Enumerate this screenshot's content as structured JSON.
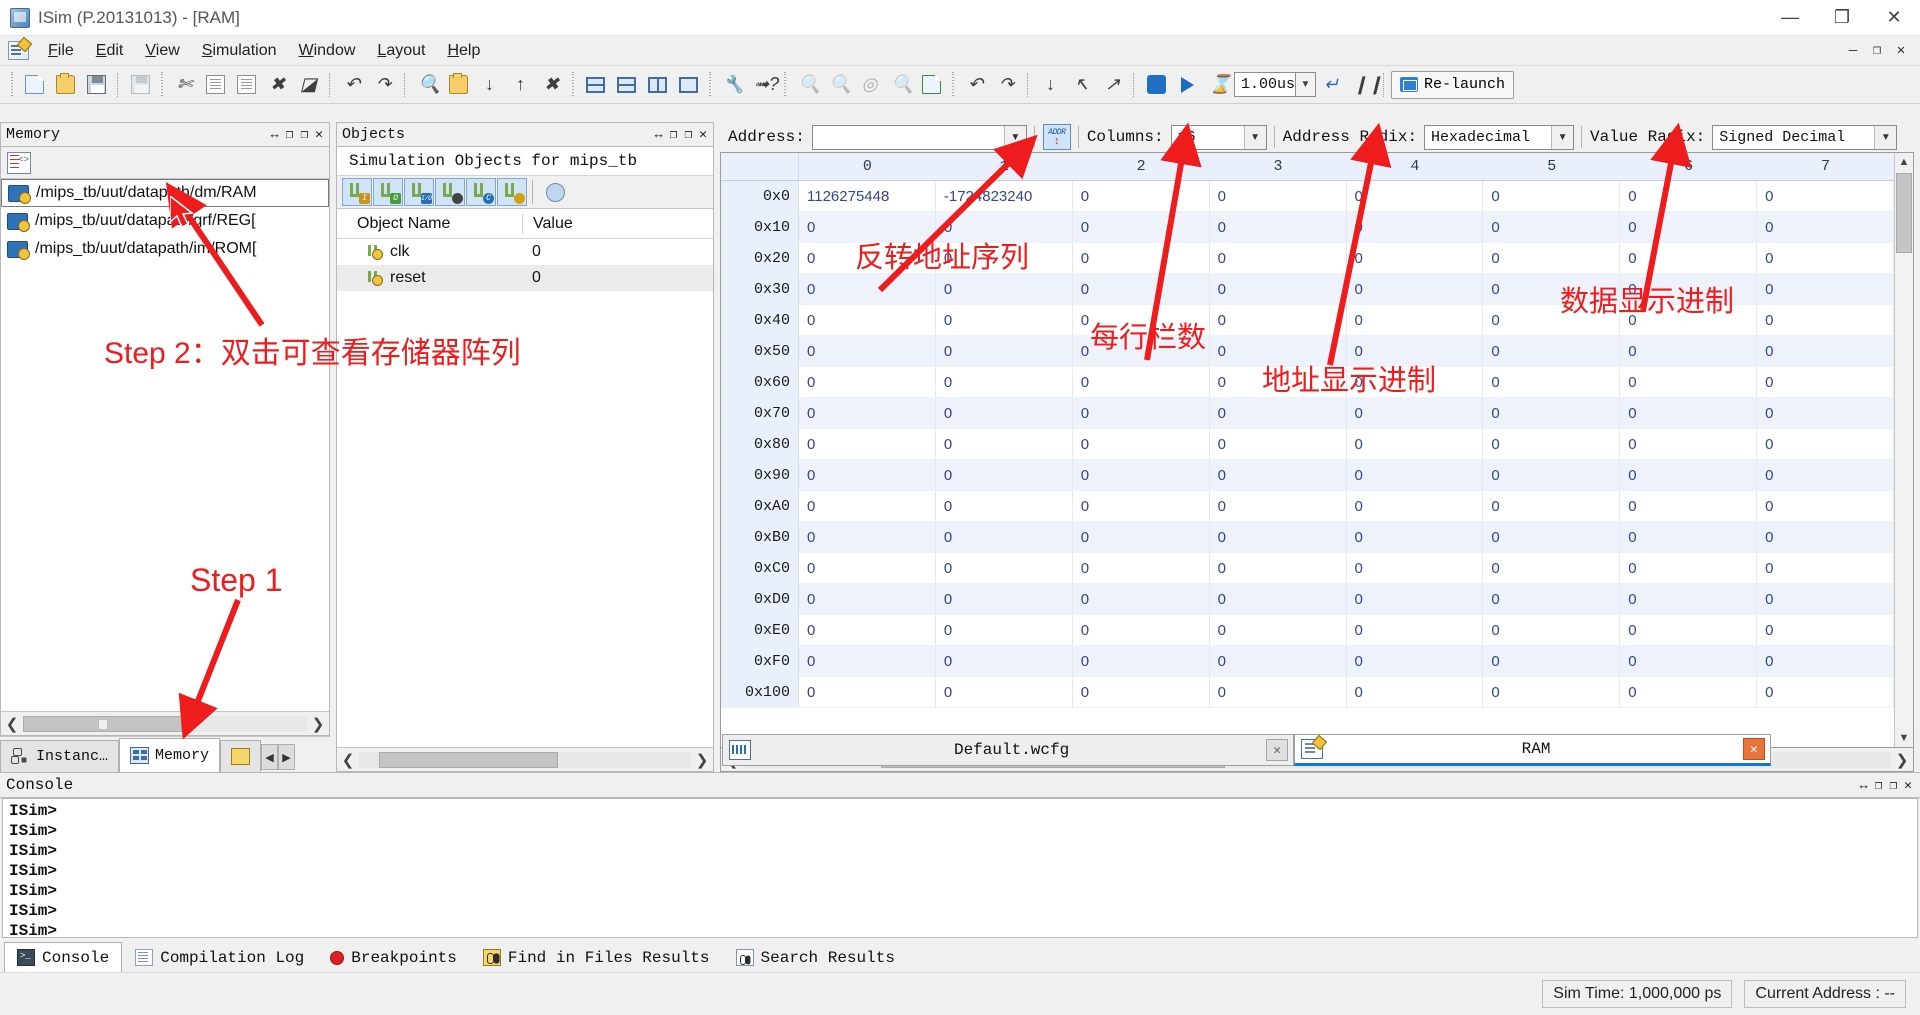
{
  "window": {
    "title": "ISim (P.20131013) - [RAM]",
    "app_icon": "isim-icon",
    "minimize": "—",
    "maximize": "❐",
    "close": "✕"
  },
  "menubar": {
    "items": [
      {
        "label": "File",
        "mnemonic": "F"
      },
      {
        "label": "Edit",
        "mnemonic": "E"
      },
      {
        "label": "View",
        "mnemonic": "V"
      },
      {
        "label": "Simulation",
        "mnemonic": "S"
      },
      {
        "label": "Window",
        "mnemonic": "W"
      },
      {
        "label": "Layout",
        "mnemonic": "L"
      },
      {
        "label": "Help",
        "mnemonic": "H"
      }
    ],
    "mdi_buttons": [
      "—",
      "❐",
      "✕"
    ]
  },
  "toolbar": {
    "groups": [
      {
        "buttons": [
          {
            "name": "new-file-icon"
          },
          {
            "name": "open-file-icon"
          },
          {
            "name": "save-icon"
          },
          {
            "name": "print-icon"
          }
        ]
      },
      {
        "buttons": [
          {
            "name": "cut-icon"
          },
          {
            "name": "copy-icon"
          },
          {
            "name": "paste-icon"
          },
          {
            "name": "delete-icon"
          },
          {
            "name": "cancel-icon"
          }
        ]
      },
      {
        "buttons": [
          {
            "name": "undo-icon"
          },
          {
            "name": "redo-icon"
          }
        ]
      },
      {
        "buttons": [
          {
            "name": "find-icon"
          },
          {
            "name": "find-in-files-icon"
          },
          {
            "name": "find-next-icon"
          },
          {
            "name": "find-prev-icon"
          },
          {
            "name": "stop-find-icon"
          }
        ]
      },
      {
        "buttons": [
          {
            "name": "tile-horizontally-icon"
          },
          {
            "name": "tile-vertically-icon"
          },
          {
            "name": "new-window-icon"
          },
          {
            "name": "cascade-icon"
          }
        ]
      },
      {
        "buttons": [
          {
            "name": "configure-icon"
          },
          {
            "name": "context-help-icon"
          }
        ]
      },
      {
        "buttons": [
          {
            "name": "zoom-in-icon"
          },
          {
            "name": "zoom-out-icon"
          },
          {
            "name": "zoom-fit-icon"
          },
          {
            "name": "zoom-select-icon"
          },
          {
            "name": "refresh-icon"
          }
        ]
      },
      {
        "buttons": [
          {
            "name": "restart-icon"
          },
          {
            "name": "run-all-icon"
          },
          {
            "name": "step-icon"
          },
          {
            "name": "back-marker-icon"
          },
          {
            "name": "forward-marker-icon"
          }
        ]
      },
      {
        "buttons": [
          {
            "name": "restart-simulation-icon"
          },
          {
            "name": "run-icon"
          },
          {
            "name": "run-for-time-icon"
          }
        ]
      }
    ],
    "run_time_value": "1.00us",
    "relaunch_label": "Re-launch",
    "step_icon": "step-into-icon",
    "pause_icon": "pause-icon"
  },
  "memory_panel": {
    "title": "Memory",
    "title_buttons": [
      "↔",
      "❐",
      "❐",
      "✕"
    ],
    "tool_icon": "memory-view-icon",
    "items": [
      {
        "label": "/mips_tb/uut/datapath/dm/RAM",
        "selected": true
      },
      {
        "label": "/mips_tb/uut/datapath/grf/REG[",
        "selected": false
      },
      {
        "label": "/mips_tb/uut/datapath/im/ROM[",
        "selected": false
      }
    ],
    "tabs": [
      {
        "label": "Instanc…",
        "icon": "instances-icon",
        "active": false
      },
      {
        "label": "Memory",
        "icon": "memory-icon",
        "active": true
      },
      {
        "label": "",
        "icon": "source-files-icon",
        "active": false
      }
    ]
  },
  "objects_panel": {
    "title": "Objects",
    "title_buttons": [
      "↔",
      "❐",
      "❐",
      "✕"
    ],
    "caption": "Simulation Objects for mips_tb",
    "filters": [
      {
        "name": "filter-input-ports",
        "badge": "I",
        "color": "#c8931f"
      },
      {
        "name": "filter-output-ports",
        "badge": "O",
        "color": "#4a9a42"
      },
      {
        "name": "filter-inout-ports",
        "badge": "I/O",
        "color": "#2a6fb5"
      },
      {
        "name": "filter-internal-signals",
        "badge": "●",
        "color": "#444444"
      },
      {
        "name": "filter-constants",
        "badge": "C",
        "color": "#2a6fb5"
      },
      {
        "name": "filter-all-signals",
        "badge": "●",
        "color": "#d4a017"
      }
    ],
    "extra_filter": {
      "name": "filter-settings-icon"
    },
    "columns": [
      "Object Name",
      "Value"
    ],
    "rows": [
      {
        "name": "clk",
        "value": "0"
      },
      {
        "name": "reset",
        "value": "0"
      }
    ]
  },
  "memory_view": {
    "address_label": "Address:",
    "address_value": "",
    "goto_address_button": "goto-address-icon",
    "columns_label": "Columns:",
    "columns_value": "16",
    "address_radix_label": "Address Radix:",
    "address_radix_value": "Hexadecimal",
    "value_radix_label": "Value Radix:",
    "value_radix_value": "Signed Decimal",
    "column_headers": [
      "0",
      "1",
      "2",
      "3",
      "4",
      "5",
      "6",
      "7"
    ],
    "rows": [
      {
        "address": "0x0",
        "values": [
          "1126275448",
          "-1724823240",
          "0",
          "0",
          "0",
          "0",
          "0",
          "0"
        ]
      },
      {
        "address": "0x10",
        "values": [
          "0",
          "0",
          "0",
          "0",
          "0",
          "0",
          "0",
          "0"
        ]
      },
      {
        "address": "0x20",
        "values": [
          "0",
          "0",
          "0",
          "0",
          "0",
          "0",
          "0",
          "0"
        ]
      },
      {
        "address": "0x30",
        "values": [
          "0",
          "0",
          "0",
          "0",
          "0",
          "0",
          "0",
          "0"
        ]
      },
      {
        "address": "0x40",
        "values": [
          "0",
          "0",
          "0",
          "0",
          "0",
          "0",
          "0",
          "0"
        ]
      },
      {
        "address": "0x50",
        "values": [
          "0",
          "0",
          "0",
          "0",
          "0",
          "0",
          "0",
          "0"
        ]
      },
      {
        "address": "0x60",
        "values": [
          "0",
          "0",
          "0",
          "0",
          "0",
          "0",
          "0",
          "0"
        ]
      },
      {
        "address": "0x70",
        "values": [
          "0",
          "0",
          "0",
          "0",
          "0",
          "0",
          "0",
          "0"
        ]
      },
      {
        "address": "0x80",
        "values": [
          "0",
          "0",
          "0",
          "0",
          "0",
          "0",
          "0",
          "0"
        ]
      },
      {
        "address": "0x90",
        "values": [
          "0",
          "0",
          "0",
          "0",
          "0",
          "0",
          "0",
          "0"
        ]
      },
      {
        "address": "0xA0",
        "values": [
          "0",
          "0",
          "0",
          "0",
          "0",
          "0",
          "0",
          "0"
        ]
      },
      {
        "address": "0xB0",
        "values": [
          "0",
          "0",
          "0",
          "0",
          "0",
          "0",
          "0",
          "0"
        ]
      },
      {
        "address": "0xC0",
        "values": [
          "0",
          "0",
          "0",
          "0",
          "0",
          "0",
          "0",
          "0"
        ]
      },
      {
        "address": "0xD0",
        "values": [
          "0",
          "0",
          "0",
          "0",
          "0",
          "0",
          "0",
          "0"
        ]
      },
      {
        "address": "0xE0",
        "values": [
          "0",
          "0",
          "0",
          "0",
          "0",
          "0",
          "0",
          "0"
        ]
      },
      {
        "address": "0xF0",
        "values": [
          "0",
          "0",
          "0",
          "0",
          "0",
          "0",
          "0",
          "0"
        ]
      },
      {
        "address": "0x100",
        "values": [
          "0",
          "0",
          "0",
          "0",
          "0",
          "0",
          "0",
          "0"
        ]
      }
    ]
  },
  "document_tabs": [
    {
      "label": "Default.wcfg",
      "icon": "waveform-icon",
      "active": false,
      "close": "✕"
    },
    {
      "label": "RAM",
      "icon": "memory-editor-icon",
      "active": true,
      "close": "✕"
    }
  ],
  "console": {
    "title": "Console",
    "title_buttons": [
      "↔",
      "❐",
      "❐",
      "✕"
    ],
    "lines": [
      "ISim>",
      "ISim>",
      "ISim>",
      "ISim>",
      "ISim>",
      "ISim>",
      "ISim>"
    ],
    "tabs": [
      {
        "label": "Console",
        "icon": "console-icon",
        "active": true
      },
      {
        "label": "Compilation Log",
        "icon": "compilation-log-icon",
        "active": false
      },
      {
        "label": "Breakpoints",
        "icon": "breakpoint-icon",
        "active": false
      },
      {
        "label": "Find in Files Results",
        "icon": "find-in-files-icon",
        "active": false
      },
      {
        "label": "Search Results",
        "icon": "search-results-icon",
        "active": false
      }
    ]
  },
  "statusbar": {
    "sim_time": "Sim Time: 1,000,000 ps",
    "current_address": "Current Address : --"
  },
  "annotations": {
    "accent_color": "#ee1c1c",
    "step1": "Step 1",
    "step2": "Step 2：双击可查看存储器阵列",
    "reverse_address": "反转地址序列",
    "columns_per_row": "每行栏数",
    "address_radix": "地址显示进制",
    "data_radix": "数据显示进制"
  }
}
